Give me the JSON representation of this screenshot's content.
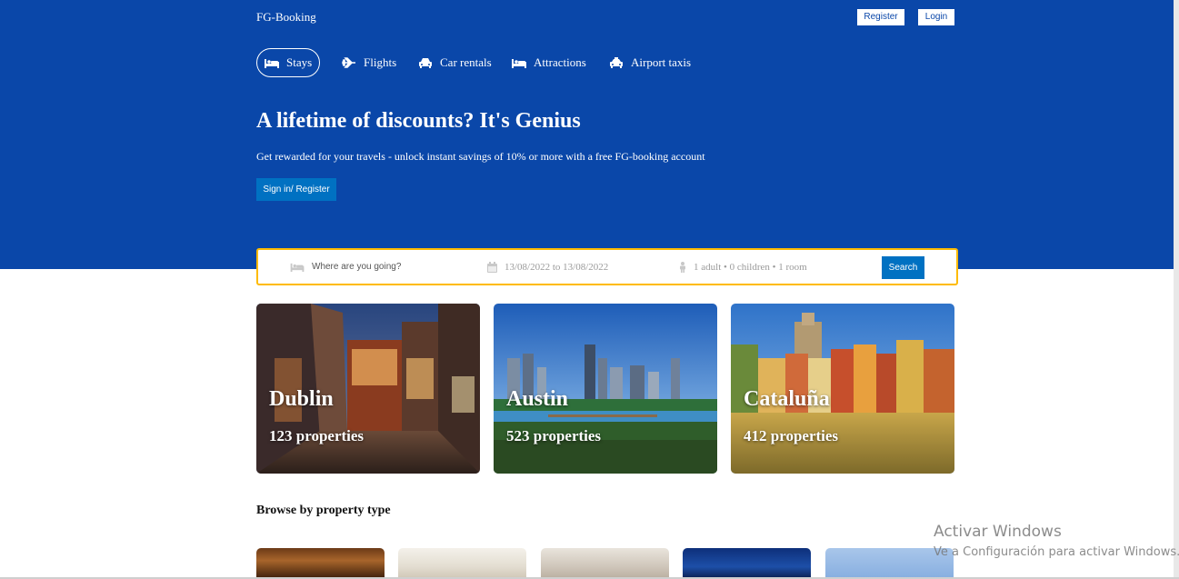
{
  "header": {
    "logo": "FG-Booking",
    "register_label": "Register",
    "login_label": "Login",
    "bg_color": "#0a47a9"
  },
  "tabs": [
    {
      "label": "Stays",
      "icon": "bed-icon",
      "active": true
    },
    {
      "label": "Flights",
      "icon": "plane-icon",
      "active": false
    },
    {
      "label": "Car rentals",
      "icon": "car-icon",
      "active": false
    },
    {
      "label": "Attractions",
      "icon": "bed-icon",
      "active": false
    },
    {
      "label": "Airport taxis",
      "icon": "taxi-icon",
      "active": false
    }
  ],
  "hero": {
    "title": "A lifetime of discounts? It's Genius",
    "subtitle": "Get rewarded for your travels - unlock instant savings of 10% or more with a free FG-booking account",
    "signin_label": "Sign in/ Register"
  },
  "search": {
    "destination_placeholder": "Where are you going?",
    "date_range": "13/08/2022 to 13/08/2022",
    "guests": "1 adult • 0 children • 1 room",
    "button_label": "Search",
    "border_color": "#febb02"
  },
  "cities": [
    {
      "name": "Dublin",
      "properties": "123 properties"
    },
    {
      "name": "Austin",
      "properties": "523 properties"
    },
    {
      "name": "Cataluña",
      "properties": "412 properties"
    }
  ],
  "browse": {
    "title": "Browse by property type"
  },
  "watermark": {
    "title": "Activar Windows",
    "subtitle": "Ve a Configuración para activar Windows."
  }
}
